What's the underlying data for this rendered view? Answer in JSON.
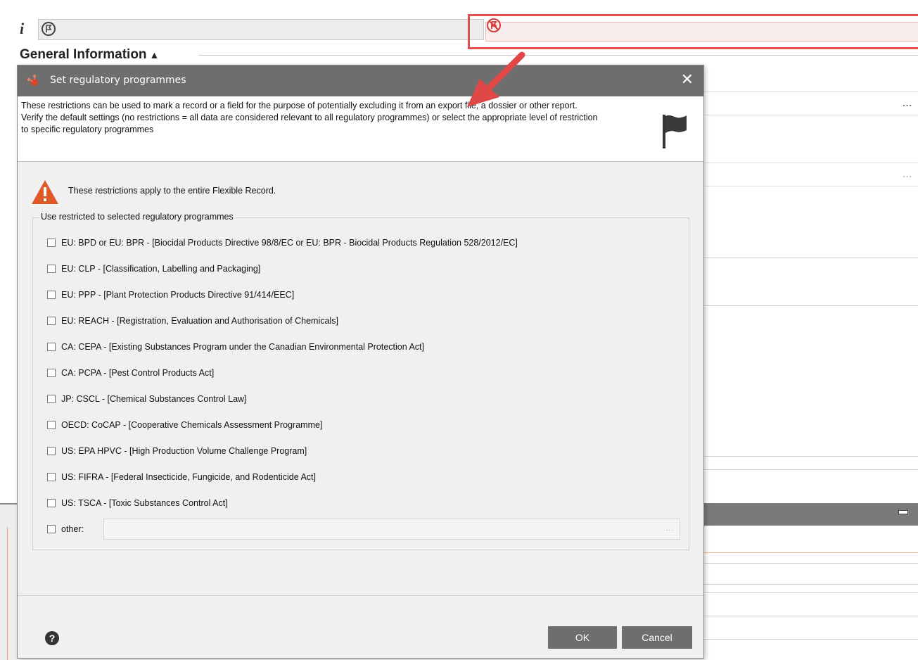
{
  "background": {
    "info_label": "i",
    "section_title": "General Information",
    "field_more": "...",
    "field_more_dim": "..."
  },
  "dialog": {
    "title": "Set regulatory programmes",
    "close_label": "✕",
    "description": "These restrictions can be used to mark a record or a field for the purpose of potentially excluding it from an export file, a dossier or other report. Verify the default settings (no restrictions = all data are considered relevant to all regulatory programmes) or select the appropriate level of restriction to specific regulatory programmes",
    "warning": "These restrictions apply to the entire Flexible Record.",
    "group_legend": "Use restricted to selected regulatory programmes",
    "programmes": [
      {
        "label": "EU: BPD or EU: BPR - [Biocidal Products Directive 98/8/EC or EU: BPR - Biocidal Products Regulation 528/2012/EC]",
        "checked": false
      },
      {
        "label": "EU: CLP - [Classification, Labelling and Packaging]",
        "checked": false
      },
      {
        "label": "EU: PPP - [Plant Protection Products Directive 91/414/EEC]",
        "checked": false
      },
      {
        "label": "EU: REACH - [Registration, Evaluation and Authorisation of Chemicals]",
        "checked": false
      },
      {
        "label": "CA: CEPA - [Existing Substances Program under the Canadian Environmental Protection Act]",
        "checked": false
      },
      {
        "label": "CA: PCPA - [Pest Control Products Act]",
        "checked": false
      },
      {
        "label": "JP: CSCL - [Chemical Substances Control Law]",
        "checked": false
      },
      {
        "label": "OECD: CoCAP - [Cooperative Chemicals Assessment Programme]",
        "checked": false
      },
      {
        "label": "US: EPA HPVC - [High Production Volume Challenge Program]",
        "checked": false
      },
      {
        "label": "US: FIFRA - [Federal Insecticide, Fungicide, and Rodenticide Act]",
        "checked": false
      },
      {
        "label": "US: TSCA - [Toxic Substances Control Act]",
        "checked": false
      }
    ],
    "other_label": "other:",
    "other_value": "",
    "other_more": "...",
    "help_label": "?",
    "ok_label": "OK",
    "cancel_label": "Cancel"
  },
  "colors": {
    "titlebar": "#6e6e6e",
    "highlight": "#e05050",
    "warning": "#e05a28"
  }
}
